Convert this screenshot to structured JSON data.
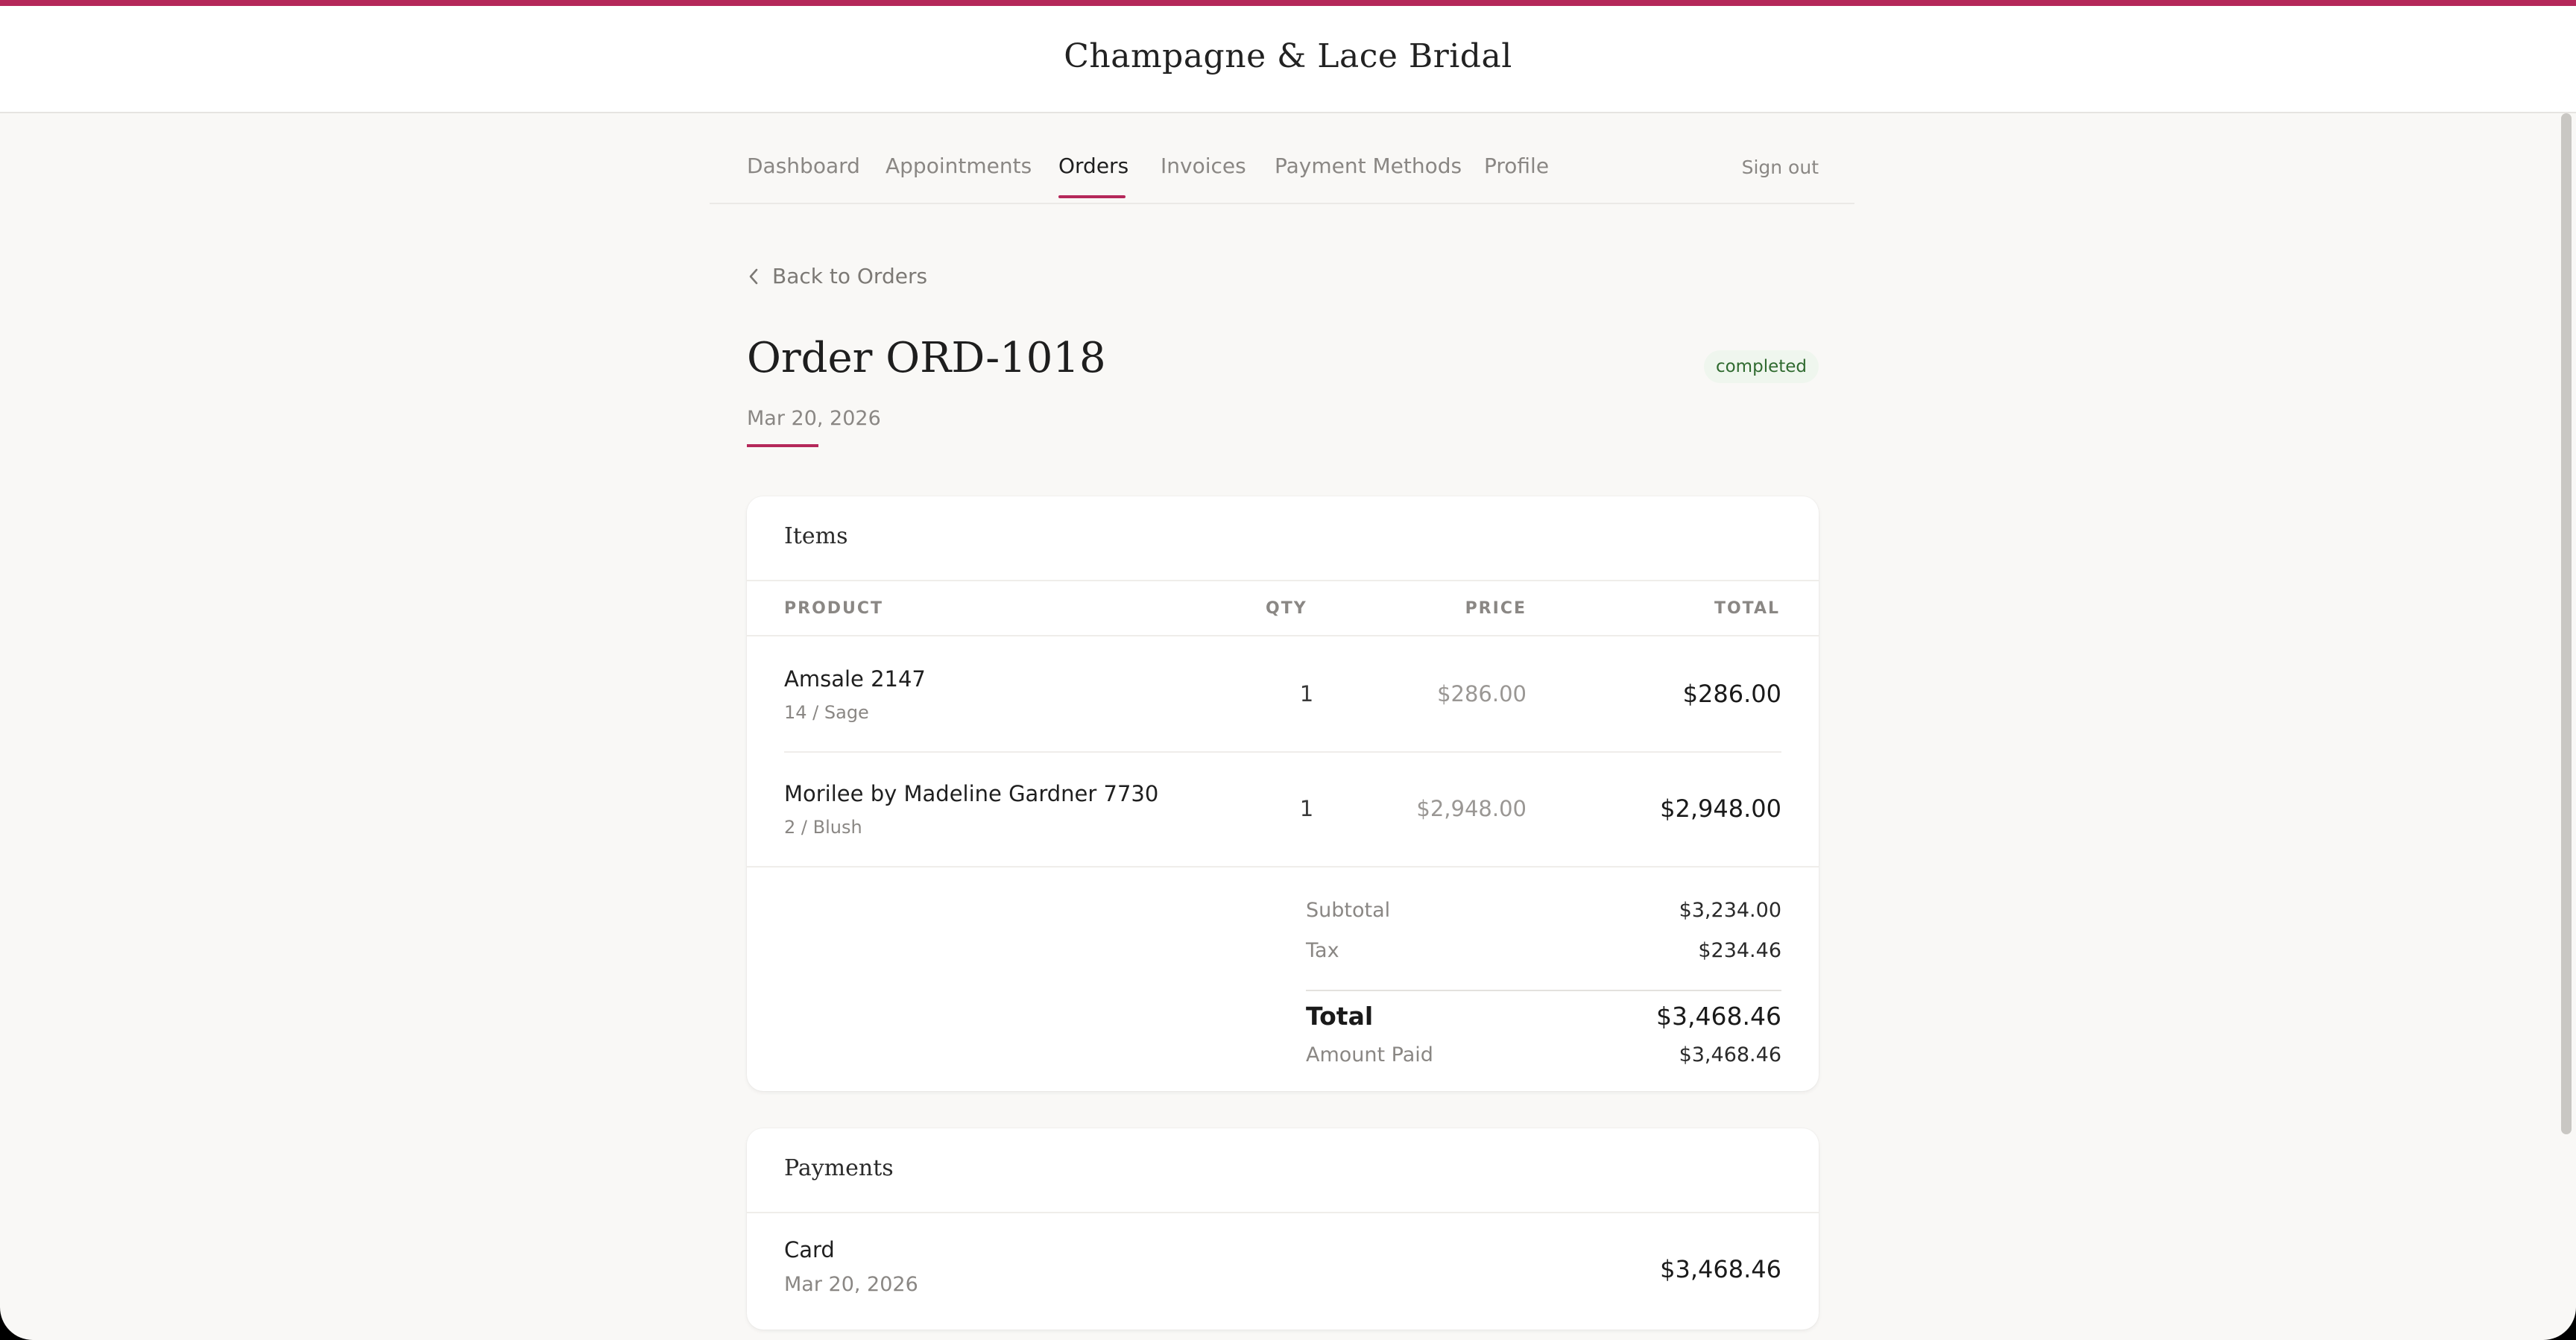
{
  "brand": {
    "name": "Champagne & Lace Bridal",
    "accent_color": "#b5285a"
  },
  "nav": {
    "items": [
      {
        "label": "Dashboard"
      },
      {
        "label": "Appointments"
      },
      {
        "label": "Orders",
        "active": true
      },
      {
        "label": "Invoices"
      },
      {
        "label": "Payment Methods"
      },
      {
        "label": "Profile"
      }
    ],
    "sign_out": "Sign out"
  },
  "back_link": {
    "label": "Back to Orders",
    "icon": "chevron-left-icon"
  },
  "order": {
    "title": "Order ORD-1018",
    "date": "Mar 20, 2026",
    "status": "completed",
    "status_color": "#2f6a2f"
  },
  "items_card": {
    "title": "Items",
    "columns": [
      "PRODUCT",
      "QTY",
      "PRICE",
      "TOTAL"
    ],
    "rows": [
      {
        "name": "Amsale 2147",
        "variant": "14 / Sage",
        "qty": "1",
        "price": "$286.00",
        "total": "$286.00"
      },
      {
        "name": "Morilee by Madeline Gardner 7730",
        "variant": "2 / Blush",
        "qty": "1",
        "price": "$2,948.00",
        "total": "$2,948.00"
      }
    ],
    "summary": {
      "subtotal_label": "Subtotal",
      "subtotal": "$3,234.00",
      "tax_label": "Tax",
      "tax": "$234.46",
      "total_label": "Total",
      "total": "$3,468.46",
      "paid_label": "Amount Paid",
      "paid": "$3,468.46"
    }
  },
  "payments_card": {
    "title": "Payments",
    "rows": [
      {
        "method": "Card",
        "date": "Mar 20, 2026",
        "amount": "$3,468.46"
      }
    ]
  }
}
